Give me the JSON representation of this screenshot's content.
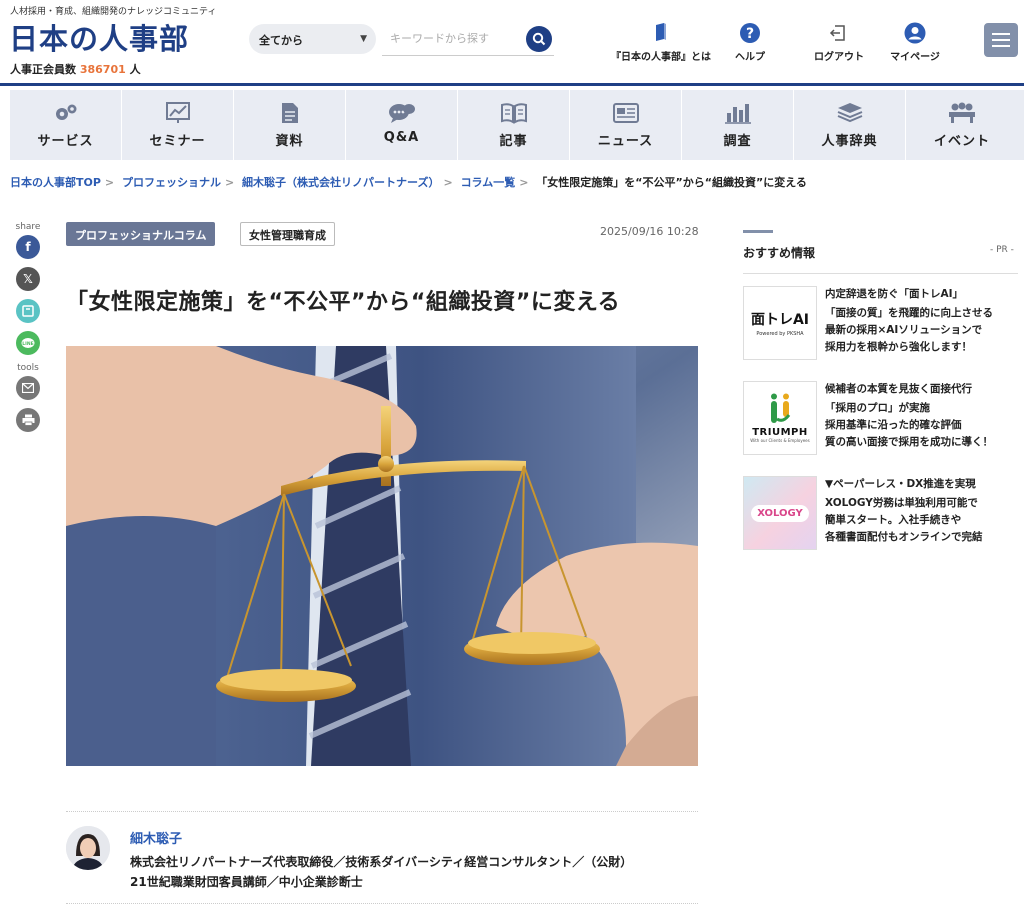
{
  "header": {
    "tagline": "人材採用・育成、組織開発のナレッジコミュニティ",
    "logo": "日本の人事部",
    "members_label": "人事正会員数",
    "members_count": "386701",
    "members_unit": "人",
    "search_scope": "全てから",
    "search_placeholder": "キーワードから探す",
    "nav": [
      {
        "label": "『日本の人事部』とは",
        "icon": "book-icon"
      },
      {
        "label": "ヘルプ",
        "icon": "help-icon"
      },
      {
        "label": "ログアウト",
        "icon": "logout-icon"
      },
      {
        "label": "マイページ",
        "icon": "user-icon"
      }
    ]
  },
  "mainnav": [
    {
      "label": "サービス",
      "icon": "gear-icon"
    },
    {
      "label": "セミナー",
      "icon": "chart-board-icon"
    },
    {
      "label": "資料",
      "icon": "document-icon"
    },
    {
      "label": "Q&A",
      "icon": "chat-icon"
    },
    {
      "label": "記事",
      "icon": "open-book-icon"
    },
    {
      "label": "ニュース",
      "icon": "newspaper-icon"
    },
    {
      "label": "調査",
      "icon": "bar-chart-icon"
    },
    {
      "label": "人事辞典",
      "icon": "stack-icon"
    },
    {
      "label": "イベント",
      "icon": "people-icon"
    }
  ],
  "breadcrumb": {
    "items": [
      "日本の人事部TOP",
      "プロフェッショナル",
      "細木聡子（株式会社リノパートナーズ）",
      "コラム一覧"
    ],
    "current": "「女性限定施策」を“不公平”から“組織投資”に変える"
  },
  "rail": {
    "share_label": "share",
    "tools_label": "tools"
  },
  "article": {
    "category": "プロフェッショナルコラム",
    "tag": "女性管理職育成",
    "date": "2025/09/16 10:28",
    "title": "「女性限定施策」を“不公平”から“組織投資”に変える"
  },
  "author": {
    "name": "細木聡子",
    "desc_line1": "株式会社リノパートナーズ代表取締役／技術系ダイバーシティ経営コンサルタント／（公財）",
    "desc_line2": "21世紀職業財団客員講師／中小企業診断士"
  },
  "sidebar": {
    "title": "おすすめ情報",
    "pr": "- PR -",
    "ads": [
      {
        "logo": "面トレAI",
        "logo_sub": "Powered by PKSHA",
        "head": "内定辞退を防ぐ「面トレAI」",
        "lines": [
          "「面接の質」を飛躍的に向上させる",
          "最新の採用×AIソリューションで",
          "採用力を根幹から強化します！"
        ]
      },
      {
        "logo": "TRIUMPH",
        "logo_sub": "With our Clients & Employees",
        "head": "候補者の本質を見抜く面接代行",
        "lines": [
          "「採用のプロ」が実施",
          "採用基準に沿った的確な評価",
          "質の高い面接で採用を成功に導く！"
        ]
      },
      {
        "logo": "XOLOGY",
        "head": "▼ペーパーレス・DX推進を実現",
        "lines": [
          "XOLOGY労務は単独利用可能で",
          "簡単スタート。入社手続きや",
          "各種書面配付もオンラインで完結"
        ]
      }
    ]
  }
}
